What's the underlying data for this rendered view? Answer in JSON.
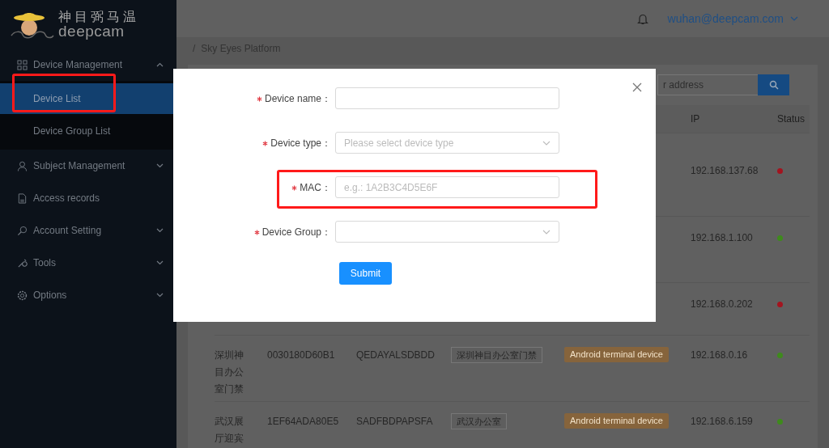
{
  "logo": {
    "title": "神目弼马温",
    "wordmark": "deepcam"
  },
  "sidebar": {
    "items": [
      {
        "label": "Device Management",
        "expanded": true,
        "children": [
          {
            "label": "Device List",
            "selected": true,
            "highlighted": true
          },
          {
            "label": "Device Group List",
            "selected": false,
            "highlighted": false
          }
        ]
      },
      {
        "label": "Subject Management",
        "expanded": false
      },
      {
        "label": "Access records"
      },
      {
        "label": "Account Setting",
        "expanded": false
      },
      {
        "label": "Tools",
        "expanded": false
      },
      {
        "label": "Options",
        "expanded": false
      }
    ]
  },
  "header": {
    "user": "wuhan@deepcam.com"
  },
  "breadcrumb": {
    "separator": "/",
    "items": [
      "Sky Eyes Platform"
    ]
  },
  "search": {
    "placeholder": "r address"
  },
  "table": {
    "columns": [
      "IP",
      "Status"
    ],
    "rows": [
      {
        "ip": "192.168.137.68",
        "color": "#a3141f"
      },
      {
        "ip": "192.168.1.100",
        "color": "#3e8a1c"
      },
      {
        "ip": "192.168.0.202",
        "color": "#a3141f"
      },
      {
        "name": "深圳神目办公室门禁",
        "column_2": "0030180D60B1",
        "column_3": "QEDAYALSDBDD",
        "group": "深圳神目办公室门禁",
        "type": "Android terminal device",
        "ip": "192.168.0.16",
        "color": "#3e8a1c"
      },
      {
        "name": "武汉展厅迎宾",
        "column_2": "1EF64ADA80E5",
        "column_3": "SADFBDPAPSFA",
        "group": "武汉办公室",
        "type": "Android terminal device",
        "ip": "192.168.6.159",
        "color": "#3e8a1c"
      }
    ]
  },
  "modal": {
    "fields": [
      {
        "label": "Device name：",
        "kind": "input",
        "required": true,
        "highlighted": false
      },
      {
        "label": "Device type：",
        "kind": "select",
        "required": true,
        "placeholder": "Please select device type",
        "highlighted": false
      },
      {
        "label": "MAC：",
        "kind": "input",
        "required": true,
        "placeholder": "e.g.: 1A2B3C4D5E6F",
        "highlighted": true
      },
      {
        "label": "Device Group：",
        "kind": "select",
        "required": true,
        "highlighted": false
      }
    ],
    "submit": "Submit"
  }
}
